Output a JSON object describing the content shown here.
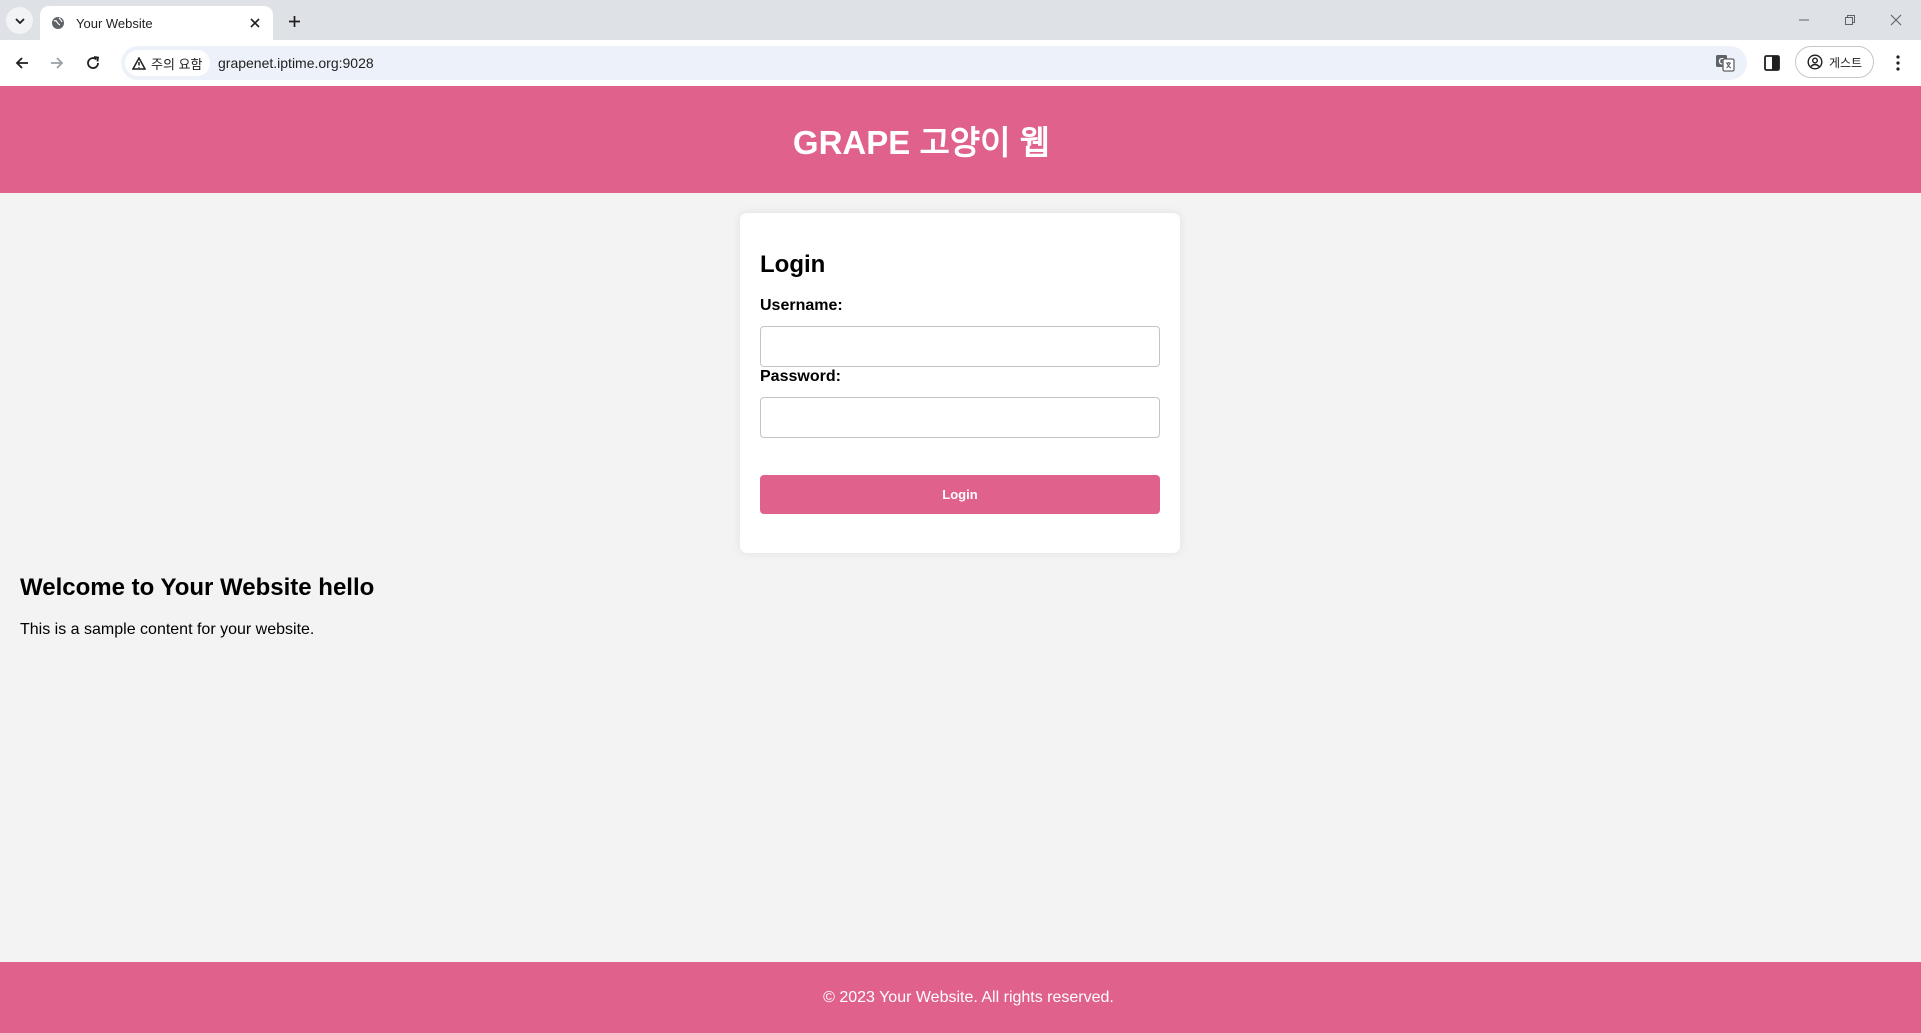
{
  "browser": {
    "tab": {
      "title": "Your Website"
    },
    "security_chip": {
      "label": "주의 요함"
    },
    "url": "grapenet.iptime.org:9028",
    "profile": {
      "label": "게스트"
    },
    "icons": {
      "tab_search": "chevron-down-icon",
      "favicon": "globe-icon",
      "tab_close": "close-icon",
      "new_tab": "plus-icon",
      "back": "arrow-left-icon",
      "forward": "arrow-right-icon",
      "reload": "reload-icon",
      "warning": "warning-icon",
      "translate": "translate-icon",
      "side_panel": "side-panel-icon",
      "profile": "profile-icon",
      "menu": "kebab-menu-icon",
      "minimize": "minimize-icon",
      "restore": "restore-icon",
      "close_window": "close-icon"
    }
  },
  "site": {
    "header_title": "GRAPE 고양이 웹",
    "login": {
      "title": "Login",
      "username_label": "Username:",
      "username_value": "",
      "password_label": "Password:",
      "password_value": "",
      "button_label": "Login"
    },
    "main": {
      "heading": "Welcome to Your Website hello",
      "text": "This is a sample content for your website."
    },
    "footer_text": "© 2023 Your Website. All rights reserved.",
    "colors": {
      "accent": "#e0628c",
      "page_background": "#f3f3f3",
      "card_background": "#ffffff"
    }
  }
}
